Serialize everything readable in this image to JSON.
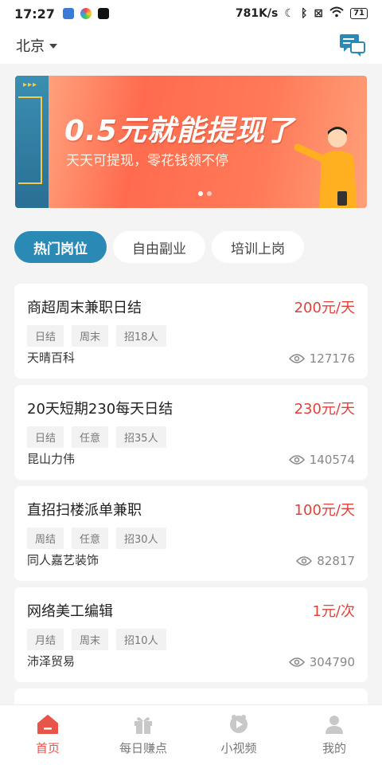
{
  "status_bar": {
    "time": "17:27",
    "network_speed": "781K/s",
    "battery": "71"
  },
  "header": {
    "city": "北京"
  },
  "banner": {
    "title": "0.5元就能提现了",
    "subtitle": "天天可提现，零花钱领不停",
    "left_arrows": "▸▸▸",
    "page_count": 2,
    "active_page": 1
  },
  "tabs": [
    {
      "label": "热门岗位",
      "active": true
    },
    {
      "label": "自由副业",
      "active": false
    },
    {
      "label": "培训上岗",
      "active": false
    }
  ],
  "jobs": [
    {
      "title": "商超周末兼职日结",
      "pay": "200元/天",
      "tags": [
        "日结",
        "周末",
        "招18人"
      ],
      "company": "天晴百科",
      "views": "127176"
    },
    {
      "title": "20天短期230每天日结",
      "pay": "230元/天",
      "tags": [
        "日结",
        "任意",
        "招35人"
      ],
      "company": "昆山力伟",
      "views": "140574"
    },
    {
      "title": "直招扫楼派单兼职",
      "pay": "100元/天",
      "tags": [
        "周结",
        "任意",
        "招30人"
      ],
      "company": "同人嘉艺装饰",
      "views": "82817"
    },
    {
      "title": "网络美工编辑",
      "pay": "1元/次",
      "tags": [
        "月结",
        "周末",
        "招10人"
      ],
      "company": "沛泽贸易",
      "views": "304790"
    }
  ],
  "bottom_nav": [
    {
      "label": "首页",
      "icon": "home-icon",
      "active": true
    },
    {
      "label": "每日赚点",
      "icon": "gift-icon",
      "active": false
    },
    {
      "label": "小视频",
      "icon": "video-icon",
      "active": false
    },
    {
      "label": "我的",
      "icon": "user-icon",
      "active": false
    }
  ],
  "colors": {
    "accent": "#2b8ab5",
    "pay": "#e0413a",
    "nav_active": "#e8534a"
  }
}
